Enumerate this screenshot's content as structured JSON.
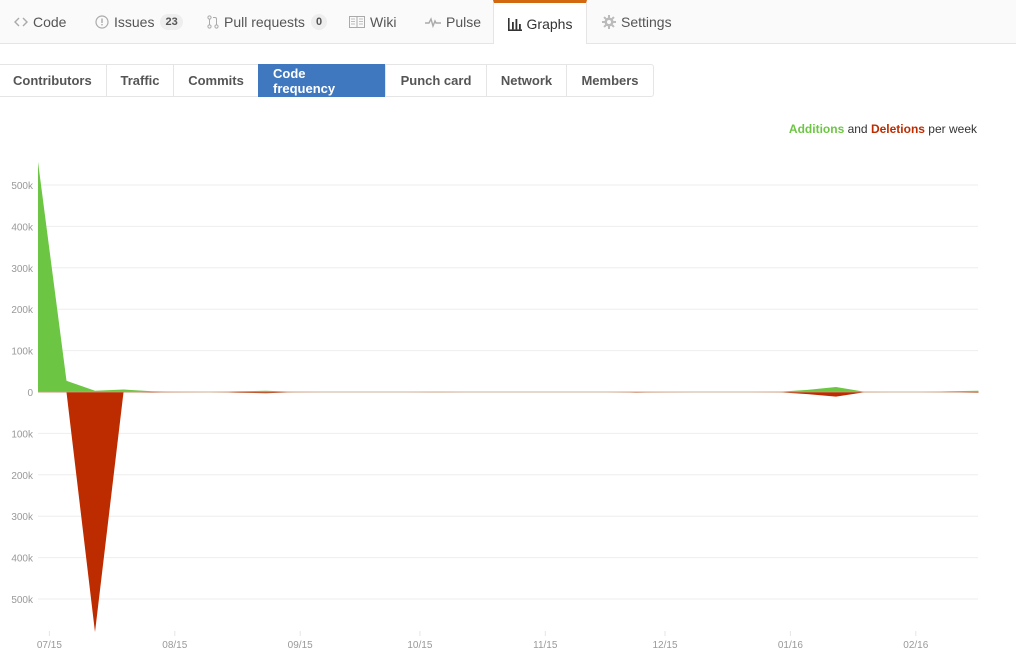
{
  "repo_nav": {
    "tabs": [
      {
        "label": "Code",
        "icon": "code-icon",
        "selected": false
      },
      {
        "label": "Issues",
        "icon": "issue-opened-icon",
        "counter": "23",
        "selected": false
      },
      {
        "label": "Pull requests",
        "icon": "git-pull-request-icon",
        "counter": "0",
        "selected": false
      },
      {
        "label": "Wiki",
        "icon": "book-icon",
        "selected": false
      },
      {
        "label": "Pulse",
        "icon": "pulse-icon",
        "selected": false
      },
      {
        "label": "Graphs",
        "icon": "graph-icon",
        "selected": true
      },
      {
        "label": "Settings",
        "icon": "gear-icon",
        "selected": false
      }
    ],
    "accent_color": "#d26911"
  },
  "graph_nav": {
    "items": [
      {
        "label": "Contributors",
        "selected": false
      },
      {
        "label": "Traffic",
        "selected": false
      },
      {
        "label": "Commits",
        "selected": false
      },
      {
        "label": "Code frequency",
        "selected": true
      },
      {
        "label": "Punch card",
        "selected": false
      },
      {
        "label": "Network",
        "selected": false
      },
      {
        "label": "Members",
        "selected": false
      }
    ],
    "selected_color": "#4078c0"
  },
  "legend": {
    "additions": "Additions",
    "and": " and ",
    "deletions": "Deletions",
    "suffix": " per week"
  },
  "chart_data": {
    "type": "area",
    "title": "Additions and Deletions per week",
    "xlabel": "",
    "ylabel": "",
    "x_tick_labels": [
      "07/15",
      "08/15",
      "09/15",
      "10/15",
      "11/15",
      "12/15",
      "01/16",
      "02/16"
    ],
    "y_tick_labels": [
      "500k",
      "400k",
      "300k",
      "200k",
      "100k",
      "0",
      "100k",
      "200k",
      "300k",
      "400k",
      "500k"
    ],
    "y_ticks": [
      500000,
      400000,
      300000,
      200000,
      100000,
      0,
      -100000,
      -200000,
      -300000,
      -400000,
      -500000
    ],
    "ylim": [
      -580000,
      560000
    ],
    "x_tick_week_index": [
      0.4,
      4.8,
      9.2,
      13.4,
      17.8,
      22.0,
      26.4,
      30.8
    ],
    "grid": true,
    "colors": {
      "additions": "#6cc644",
      "deletions": "#bd2c00"
    },
    "series": [
      {
        "name": "Additions",
        "values": [
          556000,
          27000,
          3000,
          6000,
          2000,
          500,
          0,
          2000,
          3000,
          500,
          0,
          0,
          0,
          0,
          500,
          0,
          0,
          0,
          0,
          0,
          0,
          500,
          0,
          0,
          0,
          0,
          500,
          5000,
          12000,
          500,
          0,
          0,
          2000,
          3000
        ]
      },
      {
        "name": "Deletions",
        "values": [
          -500,
          -1000,
          -580000,
          -1000,
          -1500,
          -500,
          0,
          -2000,
          -3000,
          -500,
          0,
          0,
          0,
          0,
          -800,
          0,
          0,
          0,
          0,
          0,
          0,
          -1500,
          -500,
          0,
          0,
          0,
          -500,
          -5000,
          -11000,
          -500,
          0,
          0,
          -1000,
          -2000
        ]
      }
    ]
  }
}
